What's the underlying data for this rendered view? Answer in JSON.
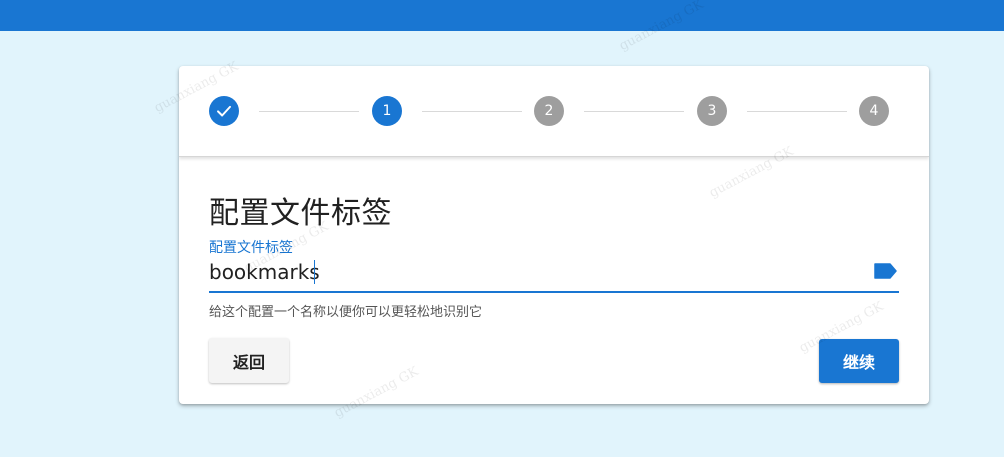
{
  "stepper": {
    "steps": [
      {
        "label": "",
        "state": "done"
      },
      {
        "label": "1",
        "state": "active"
      },
      {
        "label": "2",
        "state": "inactive"
      },
      {
        "label": "3",
        "state": "inactive"
      },
      {
        "label": "4",
        "state": "inactive"
      }
    ]
  },
  "form": {
    "title": "配置文件标签",
    "field_label": "配置文件标签",
    "field_value": "bookmarks",
    "hint": "给这个配置一个名称以便你可以更轻松地识别它",
    "icon": "label-icon"
  },
  "actions": {
    "back_label": "返回",
    "continue_label": "继续"
  },
  "watermark": "guanxiang GK",
  "colors": {
    "primary": "#1976d2",
    "background": "#e1f4fc",
    "inactive_step": "#9e9e9e"
  }
}
